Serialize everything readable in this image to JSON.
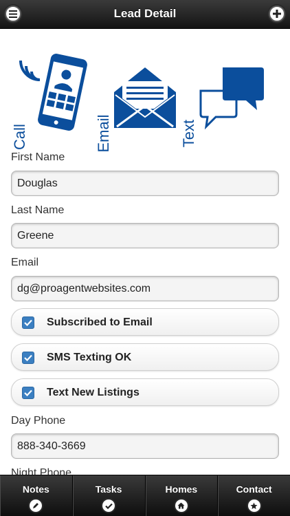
{
  "header": {
    "title": "Lead Detail",
    "menu_icon": "menu-icon",
    "add_icon": "plus-icon"
  },
  "contact_methods": [
    {
      "label": "Call",
      "icon": "phone-icon"
    },
    {
      "label": "Email",
      "icon": "envelope-icon"
    },
    {
      "label": "Text",
      "icon": "chat-bubbles-icon"
    }
  ],
  "form": {
    "first_name_label": "First Name",
    "first_name_value": "Douglas",
    "last_name_label": "Last Name",
    "last_name_value": "Greene",
    "email_label": "Email",
    "email_value": "dg@proagentwebsites.com",
    "checkboxes": [
      {
        "label": "Subscribed to Email",
        "checked": true
      },
      {
        "label": "SMS Texting OK",
        "checked": true
      },
      {
        "label": "Text New Listings",
        "checked": true
      }
    ],
    "day_phone_label": "Day Phone",
    "day_phone_value": "888-340-3669",
    "night_phone_label": "Night Phone"
  },
  "footer": {
    "tabs": [
      {
        "label": "Notes",
        "icon": "pencil-icon"
      },
      {
        "label": "Tasks",
        "icon": "check-icon"
      },
      {
        "label": "Homes",
        "icon": "home-icon"
      },
      {
        "label": "Contact",
        "icon": "star-icon"
      }
    ]
  },
  "colors": {
    "brand_blue": "#0b4e9c",
    "checkbox_blue": "#3b7fc1",
    "header_dark": "#1c1c1c"
  }
}
